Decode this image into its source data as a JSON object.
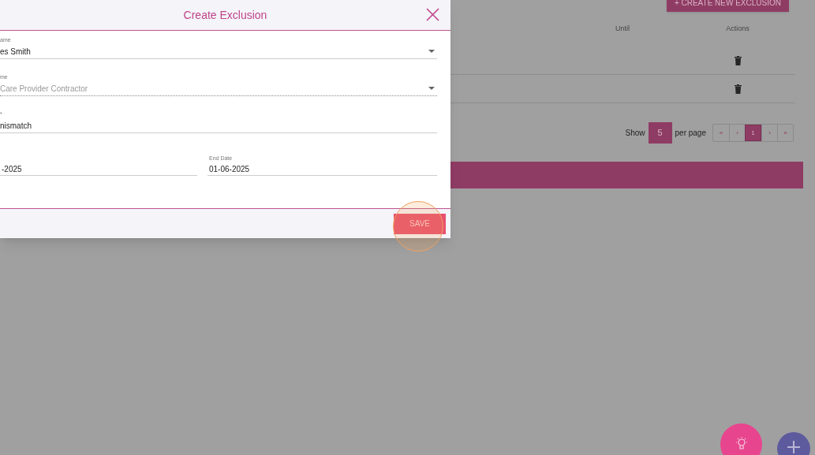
{
  "page": {
    "create_button": "+ CREATE NEW EXCLUSION",
    "columns": [
      "Until",
      "Actions"
    ],
    "rows": [
      {
        "kind": "delete"
      },
      {
        "kind": "delete"
      }
    ],
    "pagination": {
      "show_label": "Show",
      "page_size": "5",
      "per_page_label": "per page",
      "buttons": [
        {
          "label": "«",
          "selected": false
        },
        {
          "label": "‹",
          "selected": false
        },
        {
          "label": "1",
          "selected": true
        },
        {
          "label": "›",
          "selected": false
        },
        {
          "label": "»",
          "selected": false
        }
      ]
    }
  },
  "dialog": {
    "title": "Create Exclusion",
    "fields": [
      {
        "kind": "select",
        "label": "ame",
        "value": "es Smith",
        "disabled": false
      },
      {
        "kind": "select",
        "label": "me",
        "value": "Care Provider Contractor",
        "disabled": true
      },
      {
        "kind": "text",
        "label": "*",
        "value": "nismatch",
        "disabled": false
      }
    ],
    "dates": [
      {
        "value": "-2025"
      },
      {
        "label": "End Date",
        "value": "01-06-2025"
      }
    ],
    "save_button": "SAVE"
  }
}
